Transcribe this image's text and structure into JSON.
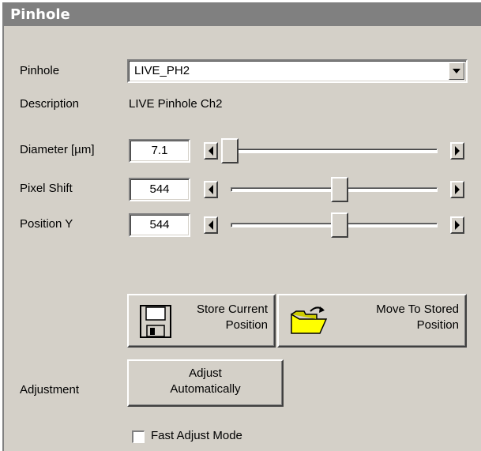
{
  "panel": {
    "title": "Pinhole"
  },
  "pinhole": {
    "label": "Pinhole",
    "selected": "LIVE_PH2",
    "description_label": "Description",
    "description_value": "LIVE Pinhole Ch2"
  },
  "diameter": {
    "label": "Diameter [µm]",
    "value": "7.1",
    "slider_fraction": 0.0
  },
  "pixel_shift": {
    "label": "Pixel Shift",
    "value": "544",
    "slider_fraction": 0.53
  },
  "position_y": {
    "label": "Position Y",
    "value": "544",
    "slider_fraction": 0.53
  },
  "buttons": {
    "store_line1": "Store Current",
    "store_line2": "Position",
    "move_line1": "Move To Stored",
    "move_line2": "Position",
    "adjust_line1": "Adjust",
    "adjust_line2": "Automatically"
  },
  "adjustment": {
    "label": "Adjustment"
  },
  "fast_adjust": {
    "label": "Fast Adjust Mode",
    "checked": false
  },
  "icons": {
    "save": "floppy-disk-icon",
    "move": "folder-arrow-icon"
  }
}
